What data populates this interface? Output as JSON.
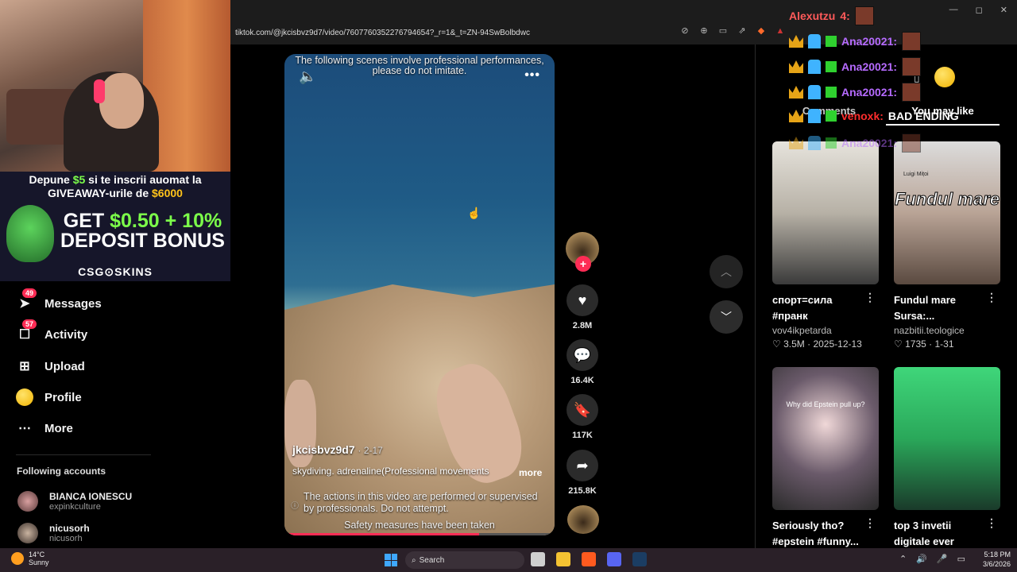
{
  "browser": {
    "url": "tiktok.com/@jkcisbvz9d7/video/7607760352276794654?_r=1&_t=ZN-94SwBolbdwc"
  },
  "stream": {
    "promo_line1_pre": "Depune ",
    "promo_line1_amount": "$5",
    "promo_line1_post": " si te inscrii auomat la",
    "promo_line2_pre": "GIVEAWAY-urile de ",
    "promo_line2_amount": "$6000",
    "promo_big_line1": "GET ",
    "promo_big_amount": "$0.50 + 10%",
    "promo_big_line2": "DEPOSIT BONUS",
    "promo_logo": "CSG⊙SKINS"
  },
  "sidebar": {
    "items": [
      {
        "label": "Messages",
        "badge": "49",
        "icon": "send-icon"
      },
      {
        "label": "Activity",
        "badge": "57",
        "icon": "inbox-icon"
      },
      {
        "label": "Upload",
        "badge": "",
        "icon": "plus-square-icon"
      },
      {
        "label": "Profile",
        "badge": "",
        "icon": "avatar-icon"
      },
      {
        "label": "More",
        "badge": "",
        "icon": "more-icon"
      }
    ],
    "following_title": "Following accounts",
    "accounts": [
      {
        "name": "BIANCA IONESCU",
        "handle": "expinkculture"
      },
      {
        "name": "nicusorh",
        "handle": "nicusorh"
      }
    ]
  },
  "video": {
    "top_note": "The following scenes involve professional performances, please do not imitate.",
    "author": "jkcisbvz9d7",
    "date": "· 2-17",
    "description": "skydiving. adrenaline(Professional movements",
    "more_label": "more",
    "warning": "The actions in this video are performed or supervised by professionals. Do not attempt.",
    "safety": "Safety measures have been taken",
    "progress_fraction": 0.72
  },
  "actions": {
    "likes": "2.8M",
    "comments": "16.4K",
    "saves": "117K",
    "shares": "215.8K"
  },
  "right_panel": {
    "tabs": [
      "Comments",
      "You may like"
    ],
    "cards": [
      {
        "title": "спорт=сила #пранк",
        "author": "vov4ikpetarda",
        "likes": "3.5M",
        "date": "2025-12-13"
      },
      {
        "title": "Fundul mare Sursa:...",
        "author": "nazbitii.teologice",
        "likes": "1735",
        "date": "1-31",
        "overlay": "Fundul mare",
        "caption_top": "Luigi Mițoi"
      },
      {
        "title": "Seriously tho? #epstein #funny...",
        "author": "",
        "likes": "",
        "date": "",
        "overlay": "Why did Epstein pull up?"
      },
      {
        "title": "top 3 invetii digitale ever",
        "author": "",
        "likes": "",
        "date": ""
      }
    ]
  },
  "chat": {
    "lines": [
      {
        "user": "Alexutzu",
        "text": "4:",
        "color": "#ff5a5a"
      },
      {
        "user": "Ana20021:",
        "text": "",
        "color": "#b66bff"
      },
      {
        "user": "Ana20021:",
        "text": "",
        "color": "#b66bff"
      },
      {
        "user": "Ana20021:",
        "text": "",
        "color": "#b66bff"
      },
      {
        "user": "venoxk:",
        "text": "BAD ENDING",
        "color": "#ff2d2d"
      },
      {
        "user": "Ana20021:",
        "text": "",
        "color": "#b66bff"
      }
    ]
  },
  "taskbar": {
    "temp": "14°C",
    "weather": "Sunny",
    "search": "Search",
    "time": "5:18 PM",
    "date": "3/6/2026"
  }
}
